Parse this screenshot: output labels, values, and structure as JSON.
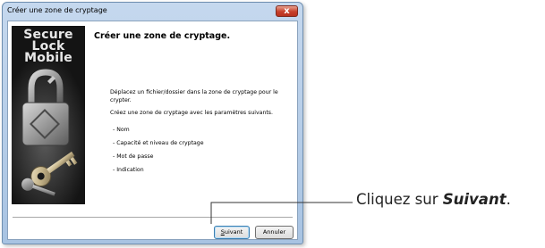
{
  "window": {
    "title": "Créer une zone de cryptage",
    "close_glyph": "x"
  },
  "side_image": {
    "logo_lines": [
      "Secure",
      "Lock",
      "Mobile"
    ]
  },
  "main": {
    "heading": "Créer une zone de cryptage.",
    "paragraph1": "Déplacez un fichier/dossier dans la zone de cryptage pour le crypter.",
    "paragraph2": "Créez une zone de cryptage avec les paramètres suivants.",
    "items": [
      "- Nom",
      "- Capacité et niveau de cryptage",
      "- Mot de passe",
      "- Indication"
    ]
  },
  "buttons": {
    "next_label_underline": "S",
    "next_label_rest": "uivant",
    "cancel_label": "Annuler"
  },
  "callout": {
    "prefix": "Cliquez sur ",
    "emphasis": "Suivant",
    "suffix": "."
  }
}
